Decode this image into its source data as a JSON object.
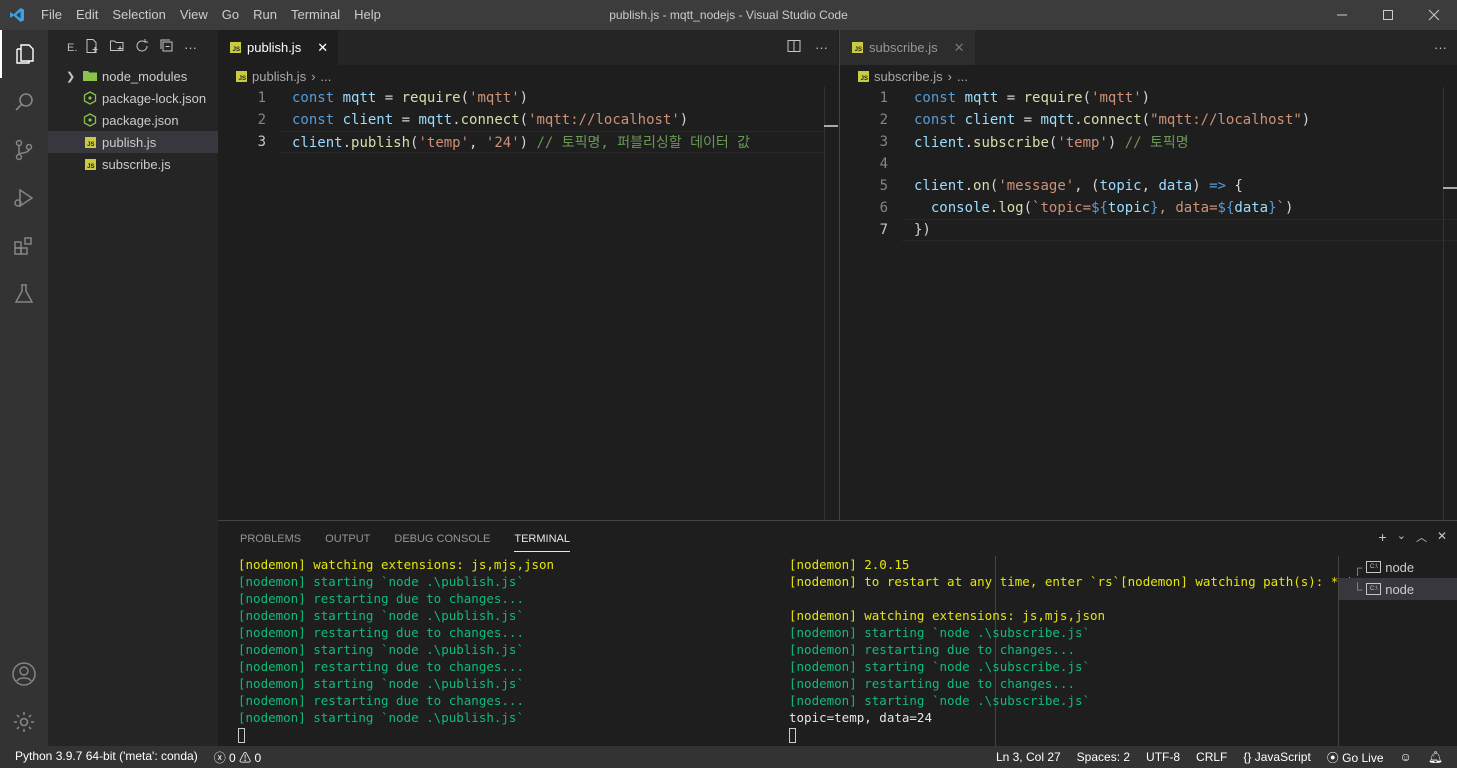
{
  "titlebar": {
    "menu": [
      "File",
      "Edit",
      "Selection",
      "View",
      "Go",
      "Run",
      "Terminal",
      "Help"
    ],
    "title": "publish.js - mqtt_nodejs - Visual Studio Code"
  },
  "sidebar": {
    "header_label": "E.",
    "items": [
      {
        "label": "node_modules",
        "icon": "folder-icon"
      },
      {
        "label": "package-lock.json",
        "icon": "json-icon"
      },
      {
        "label": "package.json",
        "icon": "json-icon"
      },
      {
        "label": "publish.js",
        "icon": "js-icon"
      },
      {
        "label": "subscribe.js",
        "icon": "js-icon"
      }
    ]
  },
  "editor_left": {
    "tab_label": "publish.js",
    "breadcrumb_file": "publish.js",
    "breadcrumb_more": "...",
    "lines": [
      {
        "no": "1",
        "parts": [
          [
            "kw",
            "const"
          ],
          [
            "br",
            " "
          ],
          [
            "var",
            "mqtt"
          ],
          [
            "br",
            " = "
          ],
          [
            "fn",
            "require"
          ],
          [
            "br",
            "("
          ],
          [
            "str",
            "'mqtt'"
          ],
          [
            "br",
            ")"
          ]
        ]
      },
      {
        "no": "2",
        "parts": [
          [
            "kw",
            "const"
          ],
          [
            "br",
            " "
          ],
          [
            "var",
            "client"
          ],
          [
            "br",
            " = "
          ],
          [
            "var",
            "mqtt"
          ],
          [
            "br",
            "."
          ],
          [
            "fn",
            "connect"
          ],
          [
            "br",
            "("
          ],
          [
            "str",
            "'mqtt://localhost'"
          ],
          [
            "br",
            ")"
          ]
        ]
      },
      {
        "no": "3",
        "parts": [
          [
            "var",
            "client"
          ],
          [
            "br",
            "."
          ],
          [
            "fn",
            "publish"
          ],
          [
            "br",
            "("
          ],
          [
            "str",
            "'temp'"
          ],
          [
            "br",
            ", "
          ],
          [
            "str",
            "'24'"
          ],
          [
            "br",
            ")"
          ],
          [
            "br",
            " "
          ],
          [
            "cm",
            "// 토픽명, 퍼블리싱할 데이터 값"
          ]
        ]
      }
    ]
  },
  "editor_right": {
    "tab_label": "subscribe.js",
    "breadcrumb_file": "subscribe.js",
    "breadcrumb_more": "...",
    "lines": [
      {
        "no": "1",
        "parts": [
          [
            "kw",
            "const"
          ],
          [
            "br",
            " "
          ],
          [
            "var",
            "mqtt"
          ],
          [
            "br",
            " = "
          ],
          [
            "fn",
            "require"
          ],
          [
            "br",
            "("
          ],
          [
            "str",
            "'mqtt'"
          ],
          [
            "br",
            ")"
          ]
        ]
      },
      {
        "no": "2",
        "parts": [
          [
            "kw",
            "const"
          ],
          [
            "br",
            " "
          ],
          [
            "var",
            "client"
          ],
          [
            "br",
            " = "
          ],
          [
            "var",
            "mqtt"
          ],
          [
            "br",
            "."
          ],
          [
            "fn",
            "connect"
          ],
          [
            "br",
            "("
          ],
          [
            "str",
            "\"mqtt://localhost\""
          ],
          [
            "br",
            ")"
          ]
        ]
      },
      {
        "no": "3",
        "parts": [
          [
            "var",
            "client"
          ],
          [
            "br",
            "."
          ],
          [
            "fn",
            "subscribe"
          ],
          [
            "br",
            "("
          ],
          [
            "str",
            "'temp'"
          ],
          [
            "br",
            ") "
          ],
          [
            "cm",
            "// 토픽명"
          ]
        ]
      },
      {
        "no": "4",
        "parts": []
      },
      {
        "no": "5",
        "parts": [
          [
            "var",
            "client"
          ],
          [
            "br",
            "."
          ],
          [
            "fn",
            "on"
          ],
          [
            "br",
            "("
          ],
          [
            "str",
            "'message'"
          ],
          [
            "br",
            ", ("
          ],
          [
            "var",
            "topic"
          ],
          [
            "br",
            ", "
          ],
          [
            "var",
            "data"
          ],
          [
            "br",
            ") "
          ],
          [
            "kw",
            "=>"
          ],
          [
            "br",
            " {"
          ]
        ]
      },
      {
        "no": "6",
        "parts": [
          [
            "br",
            "  "
          ],
          [
            "var",
            "console"
          ],
          [
            "br",
            "."
          ],
          [
            "fn",
            "log"
          ],
          [
            "br",
            "("
          ],
          [
            "str",
            "`topic="
          ],
          [
            "kw",
            "${"
          ],
          [
            "var",
            "topic"
          ],
          [
            "kw",
            "}"
          ],
          [
            "str",
            ", data="
          ],
          [
            "kw",
            "${"
          ],
          [
            "var",
            "data"
          ],
          [
            "kw",
            "}"
          ],
          [
            "str",
            "`"
          ],
          [
            "br",
            ")"
          ]
        ]
      },
      {
        "no": "7",
        "parts": [
          [
            "br",
            "})"
          ]
        ]
      }
    ]
  },
  "panel": {
    "tabs": [
      "PROBLEMS",
      "OUTPUT",
      "DEBUG CONSOLE",
      "TERMINAL"
    ],
    "active_tab": "TERMINAL",
    "terminal_left": [
      {
        "c": "yel",
        "t": "[nodemon] watching extensions: js,mjs,json"
      },
      {
        "c": "grn",
        "t": "[nodemon] starting `node .\\publish.js`"
      },
      {
        "c": "grn",
        "t": "[nodemon] restarting due to changes..."
      },
      {
        "c": "grn",
        "t": "[nodemon] starting `node .\\publish.js`"
      },
      {
        "c": "grn",
        "t": "[nodemon] restarting due to changes..."
      },
      {
        "c": "grn",
        "t": "[nodemon] starting `node .\\publish.js`"
      },
      {
        "c": "grn",
        "t": "[nodemon] restarting due to changes..."
      },
      {
        "c": "grn",
        "t": "[nodemon] starting `node .\\publish.js`"
      },
      {
        "c": "grn",
        "t": "[nodemon] restarting due to changes..."
      },
      {
        "c": "grn",
        "t": "[nodemon] starting `node .\\publish.js`"
      }
    ],
    "terminal_right": [
      {
        "c": "yel",
        "t": "[nodemon] 2.0.15"
      },
      {
        "c": "yel",
        "t": "[nodemon] to restart at any time, enter `rs`[nodemon] watching path(s): *.*"
      },
      {
        "c": "yel",
        "t": ""
      },
      {
        "c": "yel",
        "t": "[nodemon] watching extensions: js,mjs,json"
      },
      {
        "c": "grn",
        "t": "[nodemon] starting `node .\\subscribe.js`"
      },
      {
        "c": "grn",
        "t": "[nodemon] restarting due to changes..."
      },
      {
        "c": "grn",
        "t": "[nodemon] starting `node .\\subscribe.js`"
      },
      {
        "c": "grn",
        "t": "[nodemon] restarting due to changes..."
      },
      {
        "c": "grn",
        "t": "[nodemon] starting `node .\\subscribe.js`"
      },
      {
        "c": "wht",
        "t": "topic=temp, data=24"
      }
    ],
    "terminal_list": [
      "node",
      "node"
    ]
  },
  "statusbar": {
    "python": "Python 3.9.7 64-bit ('meta': conda)",
    "errors": "0",
    "warnings": "0",
    "position": "Ln 3, Col 27",
    "spaces": "Spaces: 2",
    "encoding": "UTF-8",
    "eol": "CRLF",
    "language": "JavaScript",
    "golive": "Go Live"
  },
  "colors": {
    "accent": "#007acc",
    "statusbar_bg": "#333333",
    "js_badge": "#cbcb41"
  }
}
